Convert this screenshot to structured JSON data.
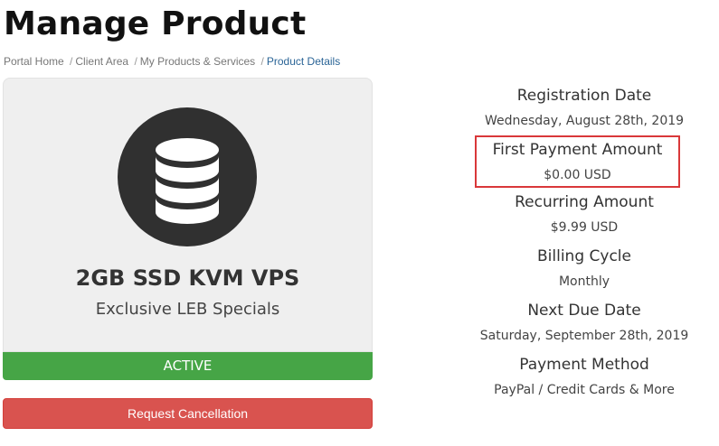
{
  "page_title": "Manage Product",
  "breadcrumb": {
    "items": [
      "Portal Home",
      "Client Area",
      "My Products & Services"
    ],
    "separator": "/",
    "active": "Product Details"
  },
  "product": {
    "icon": "database-icon",
    "name": "2GB SSD KVM VPS",
    "group": "Exclusive LEB Specials",
    "status": "ACTIVE",
    "cancel_label": "Request Cancellation"
  },
  "details": [
    {
      "label": "Registration Date",
      "value": "Wednesday, August 28th, 2019"
    },
    {
      "label": "First Payment Amount",
      "value": "$0.00 USD"
    },
    {
      "label": "Recurring Amount",
      "value": "$9.99 USD"
    },
    {
      "label": "Billing Cycle",
      "value": "Monthly"
    },
    {
      "label": "Next Due Date",
      "value": "Saturday, September 28th, 2019"
    },
    {
      "label": "Payment Method",
      "value": "PayPal / Credit Cards & More"
    }
  ],
  "colors": {
    "status_active": "#46a546",
    "cancel_button": "#d9534f",
    "highlight_border": "#d9383a",
    "breadcrumb_active": "#2a6496"
  }
}
